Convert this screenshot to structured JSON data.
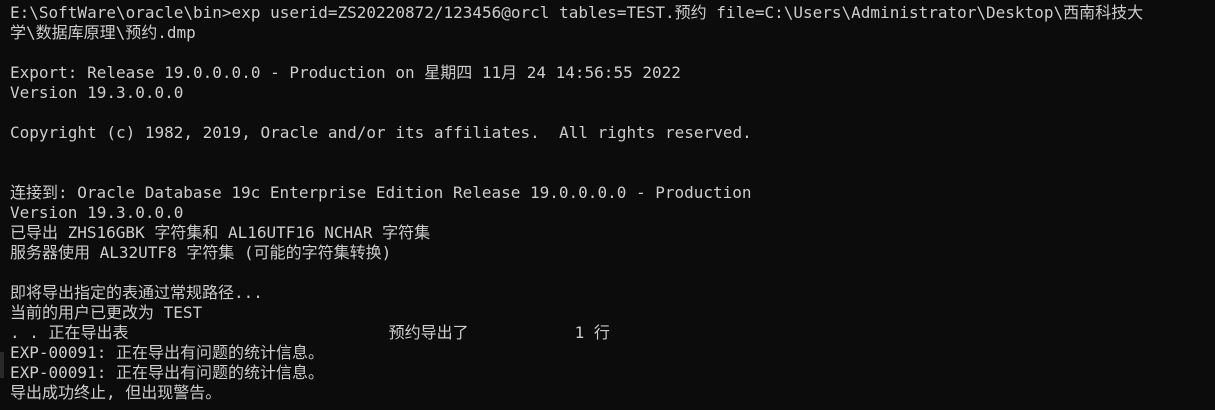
{
  "console": {
    "lines": [
      "E:\\SoftWare\\oracle\\bin>exp userid=ZS20220872/123456@orcl tables=TEST.预约 file=C:\\Users\\Administrator\\Desktop\\西南科技大",
      "学\\数据库原理\\预约.dmp",
      "Export: Release 19.0.0.0.0 - Production on 星期四 11月 24 14:56:55 2022",
      "Version 19.3.0.0.0",
      "Copyright (c) 1982, 2019, Oracle and/or its affiliates.  All rights reserved.",
      "连接到: Oracle Database 19c Enterprise Edition Release 19.0.0.0.0 - Production",
      "Version 19.3.0.0.0",
      "已导出 ZHS16GBK 字符集和 AL16UTF16 NCHAR 字符集",
      "服务器使用 AL32UTF8 字符集 (可能的字符集转换)",
      "即将导出指定的表通过常规路径...",
      "当前的用户已更改为 TEST",
      ". . 正在导出表                           预约导出了           1 行",
      "EXP-00091: 正在导出有问题的统计信息。",
      "EXP-00091: 正在导出有问题的统计信息。",
      "导出成功终止, 但出现警告。"
    ]
  }
}
